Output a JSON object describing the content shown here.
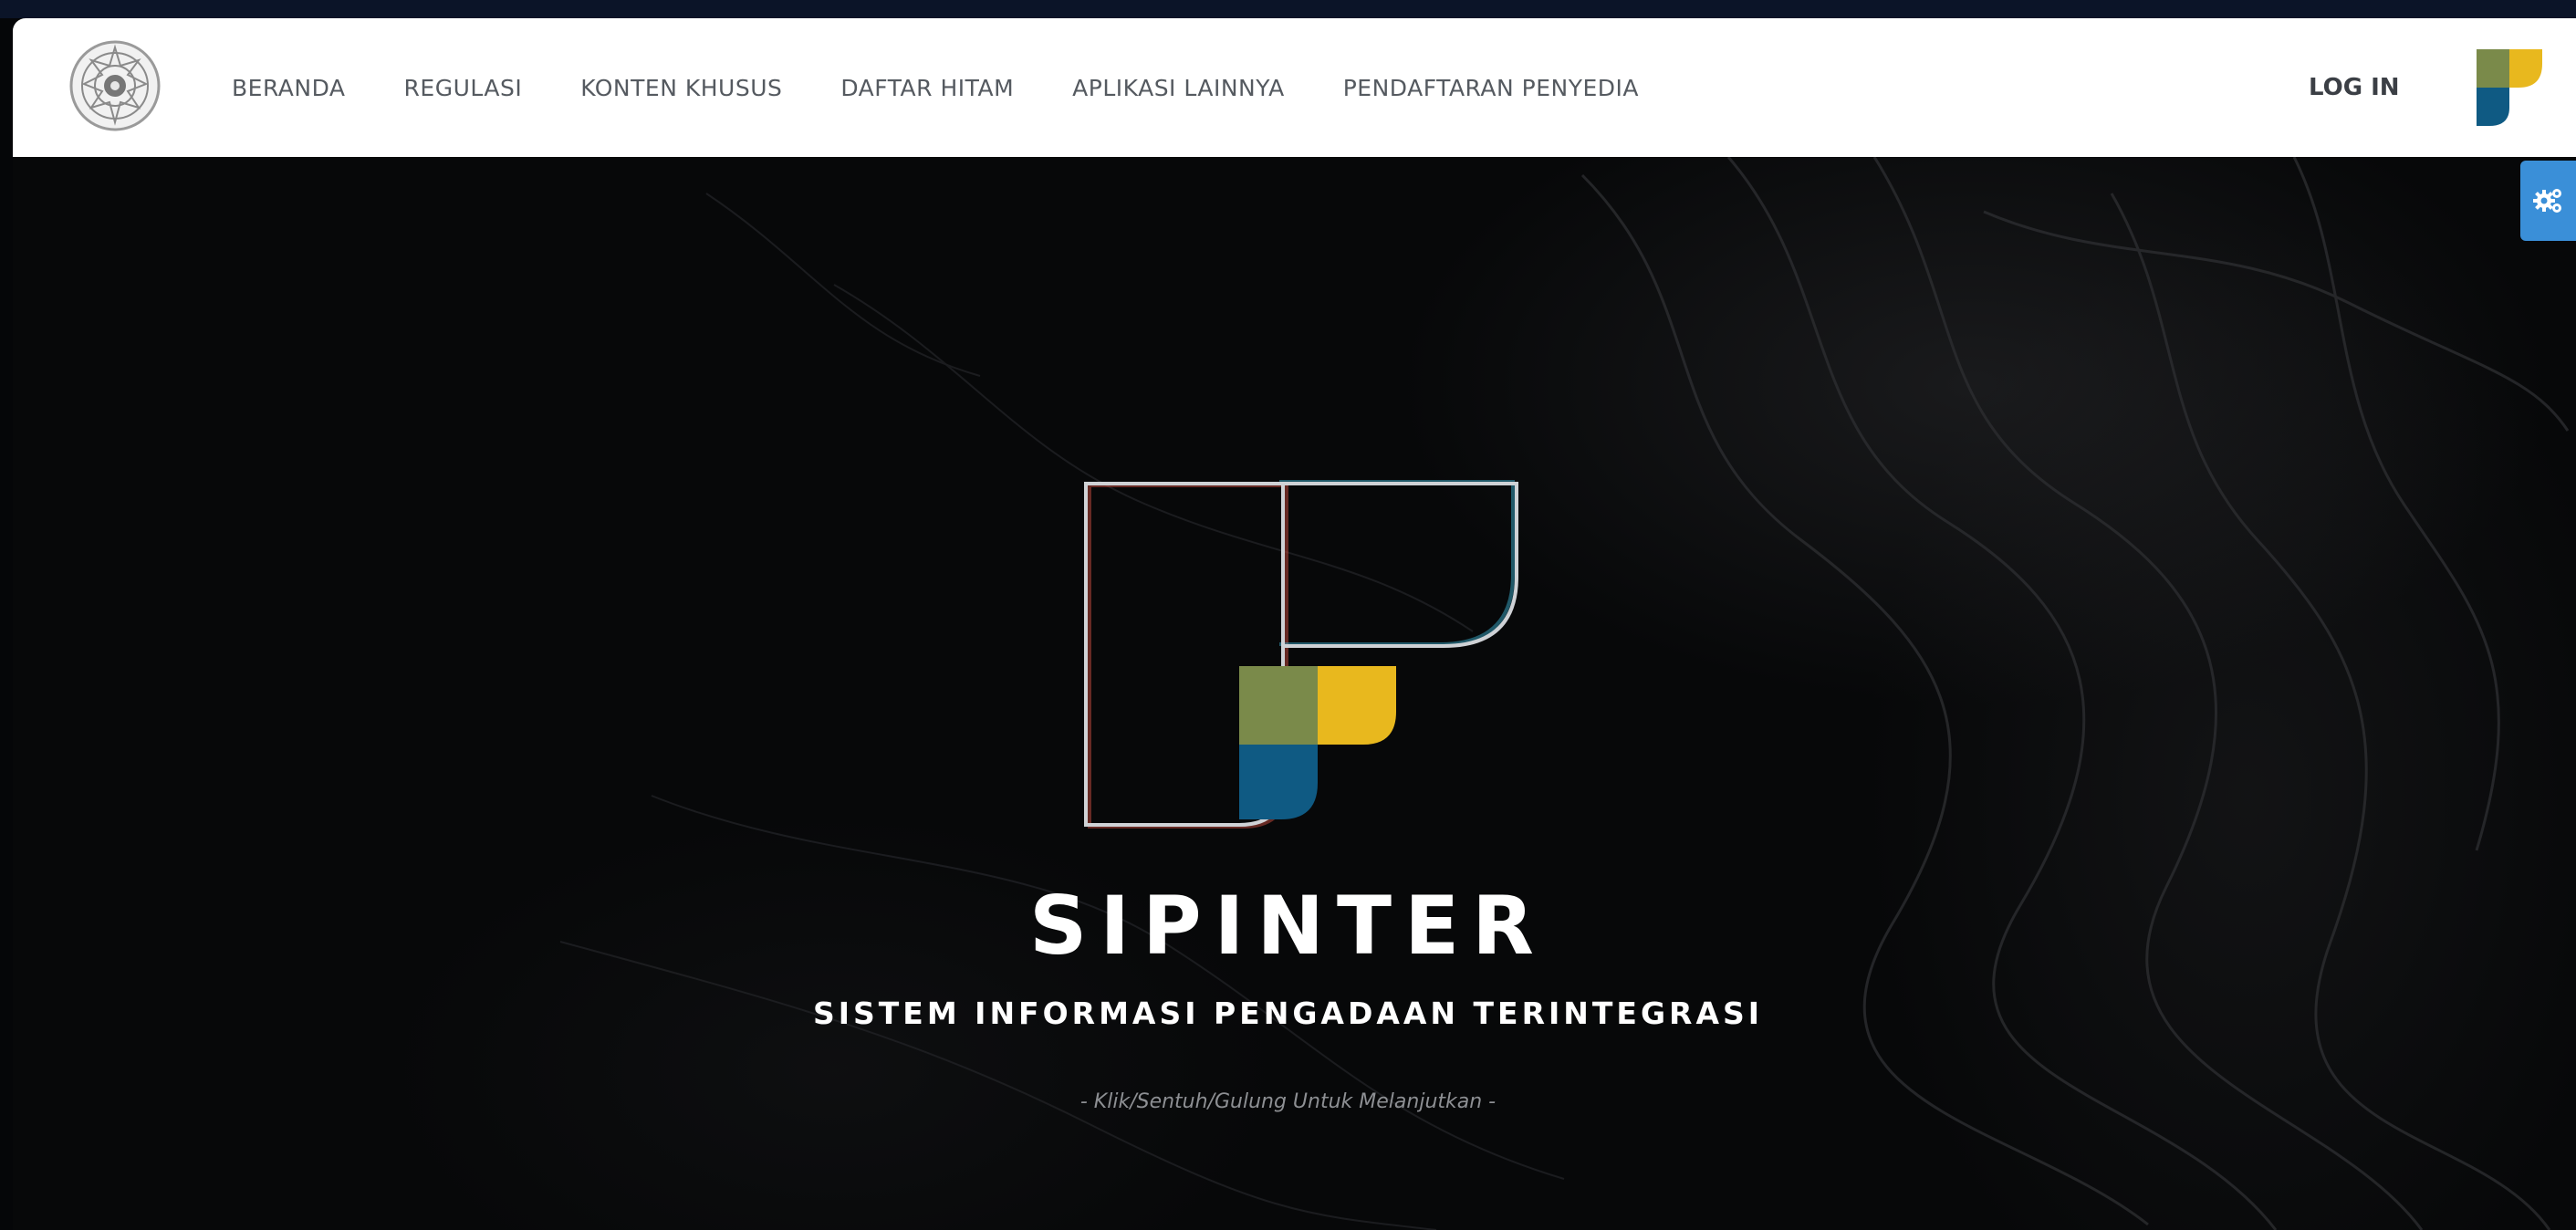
{
  "nav": {
    "items": [
      {
        "label": "BERANDA"
      },
      {
        "label": "REGULASI"
      },
      {
        "label": "KONTEN KHUSUS"
      },
      {
        "label": "DAFTAR HITAM"
      },
      {
        "label": "APLIKASI LAINNYA"
      },
      {
        "label": "PENDAFTARAN PENYEDIA"
      }
    ],
    "login_label": "LOG IN",
    "icons": {
      "left_logo": "institution-seal-icon",
      "right_logo": "sipinter-logo-icon"
    }
  },
  "hero": {
    "title": "SIPINTER",
    "subtitle": "SISTEM INFORMASI PENGADAAN TERINTEGRASI",
    "hint": "- Klik/Sentuh/Gulung Untuk Melanjutkan -"
  },
  "settings": {
    "icon": "gears-icon"
  },
  "colors": {
    "brand_green": "#7a8a4a",
    "brand_yellow": "#e8b81e",
    "brand_blue": "#0f5a83",
    "settings_blue": "#3a8fd8",
    "hero_background": "#070809"
  }
}
